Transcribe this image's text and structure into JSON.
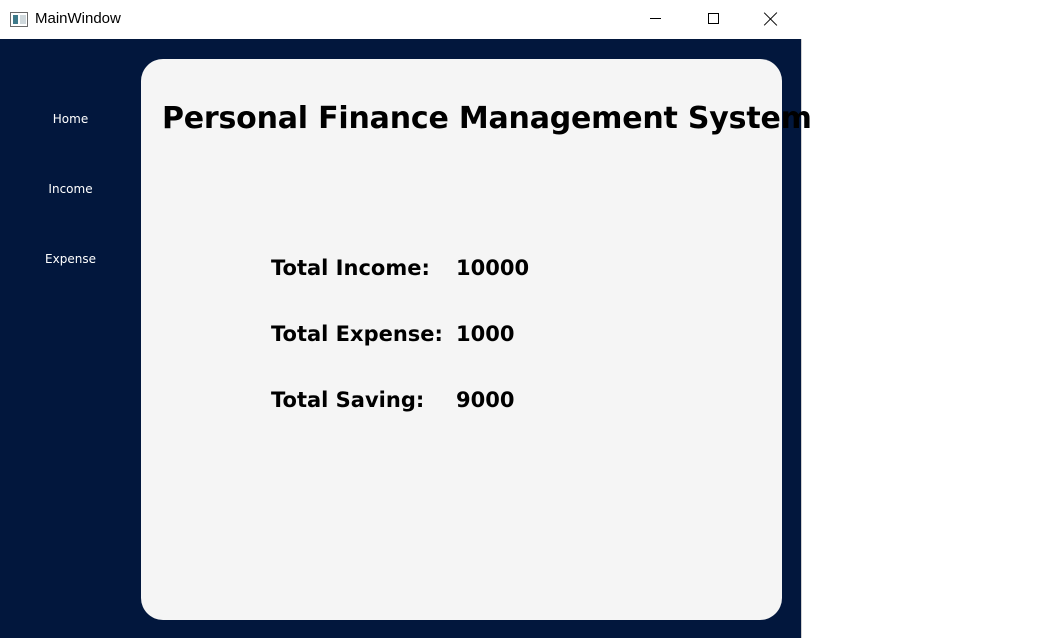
{
  "window": {
    "title": "MainWindow",
    "icon": "app-window-icon",
    "controls": {
      "minimize_icon": "minimize-icon",
      "maximize_icon": "maximize-icon",
      "close_icon": "close-icon"
    }
  },
  "sidebar": {
    "background": "#02173d",
    "items": [
      {
        "label": "Home"
      },
      {
        "label": "Income"
      },
      {
        "label": "Expense"
      }
    ]
  },
  "main": {
    "title": "Personal Finance Management System",
    "panel_background": "#f5f5f5",
    "stats": [
      {
        "label": "Total Income:",
        "value": "10000"
      },
      {
        "label": "Total Expense:",
        "value": "1000"
      },
      {
        "label": "Total Saving:",
        "value": "9000"
      }
    ]
  }
}
